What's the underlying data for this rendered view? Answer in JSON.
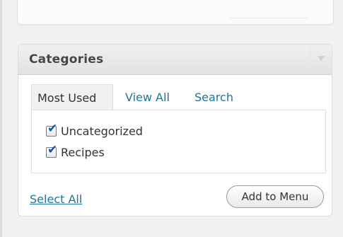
{
  "postbox": {
    "title": "Categories",
    "tabs": [
      {
        "label": "Most Used",
        "active": true
      },
      {
        "label": "View All",
        "active": false
      },
      {
        "label": "Search",
        "active": false
      }
    ],
    "items": [
      {
        "label": "Uncategorized",
        "checked": true
      },
      {
        "label": "Recipes",
        "checked": true
      }
    ],
    "select_all_label": "Select All",
    "add_button_label": "Add to Menu"
  },
  "icons": {
    "toggle": "chevron-down-icon",
    "checkbox": "checkmark-icon"
  },
  "colors": {
    "link": "#21759b",
    "checkmark": "#1c4fb4",
    "header_bg": "#e2e2e2",
    "page_bg": "#f1f1f1"
  }
}
